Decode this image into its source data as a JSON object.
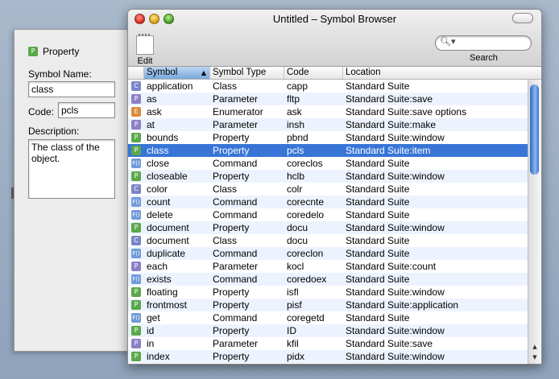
{
  "drawer": {
    "kind_label": "Property",
    "symbol_name_label": "Symbol Name:",
    "symbol_name_value": "class",
    "code_label": "Code:",
    "code_value": "pcls",
    "description_label": "Description:",
    "description_value": "The class of the object."
  },
  "window": {
    "title": "Untitled – Symbol Browser",
    "edit_label": "Edit",
    "search_label": "Search",
    "search_value": ""
  },
  "table": {
    "columns": [
      "Symbol",
      "Symbol Type",
      "Code",
      "Location"
    ],
    "sorted_column": "Symbol",
    "rows": [
      {
        "badge": "C",
        "symbol": "application",
        "type": "Class",
        "code": "capp",
        "location": "Standard Suite"
      },
      {
        "badge": "P",
        "symbol": "as",
        "type": "Parameter",
        "code": "fltp",
        "location": "Standard Suite:save"
      },
      {
        "badge": "E",
        "symbol": "ask",
        "type": "Enumerator",
        "code": "ask",
        "location": "Standard Suite:save options"
      },
      {
        "badge": "P",
        "symbol": "at",
        "type": "Parameter",
        "code": "insh",
        "location": "Standard Suite:make"
      },
      {
        "badge": "P",
        "symbol": "bounds",
        "type": "Property",
        "code": "pbnd",
        "location": "Standard Suite:window"
      },
      {
        "badge": "P",
        "symbol": "class",
        "type": "Property",
        "code": "pcls",
        "location": "Standard Suite:item"
      },
      {
        "badge": "F()",
        "symbol": "close",
        "type": "Command",
        "code": "coreclos",
        "location": "Standard Suite"
      },
      {
        "badge": "P",
        "symbol": "closeable",
        "type": "Property",
        "code": "hclb",
        "location": "Standard Suite:window"
      },
      {
        "badge": "C",
        "symbol": "color",
        "type": "Class",
        "code": "colr",
        "location": "Standard Suite"
      },
      {
        "badge": "F()",
        "symbol": "count",
        "type": "Command",
        "code": "corecnte",
        "location": "Standard Suite"
      },
      {
        "badge": "F()",
        "symbol": "delete",
        "type": "Command",
        "code": "coredelo",
        "location": "Standard Suite"
      },
      {
        "badge": "P",
        "symbol": "document",
        "type": "Property",
        "code": "docu",
        "location": "Standard Suite:window"
      },
      {
        "badge": "C",
        "symbol": "document",
        "type": "Class",
        "code": "docu",
        "location": "Standard Suite"
      },
      {
        "badge": "F()",
        "symbol": "duplicate",
        "type": "Command",
        "code": "coreclon",
        "location": "Standard Suite"
      },
      {
        "badge": "P",
        "symbol": "each",
        "type": "Parameter",
        "code": "kocl",
        "location": "Standard Suite:count"
      },
      {
        "badge": "F()",
        "symbol": "exists",
        "type": "Command",
        "code": "coredoex",
        "location": "Standard Suite"
      },
      {
        "badge": "P",
        "symbol": "floating",
        "type": "Property",
        "code": "isfl",
        "location": "Standard Suite:window"
      },
      {
        "badge": "P",
        "symbol": "frontmost",
        "type": "Property",
        "code": "pisf",
        "location": "Standard Suite:application"
      },
      {
        "badge": "F()",
        "symbol": "get",
        "type": "Command",
        "code": "coregetd",
        "location": "Standard Suite"
      },
      {
        "badge": "P",
        "symbol": "id",
        "type": "Property",
        "code": "ID",
        "location": "Standard Suite:window"
      },
      {
        "badge": "P",
        "symbol": "in",
        "type": "Parameter",
        "code": "kfil",
        "location": "Standard Suite:save"
      },
      {
        "badge": "P",
        "symbol": "index",
        "type": "Property",
        "code": "pidx",
        "location": "Standard Suite:window"
      }
    ],
    "selected_row": 5
  },
  "badge_colors": {
    "C": "#7a86c8",
    "P": "#5aa84a",
    "Parameter": "#8d7fc8",
    "E": "#d98a3a",
    "F()": "#6f9ad8"
  }
}
